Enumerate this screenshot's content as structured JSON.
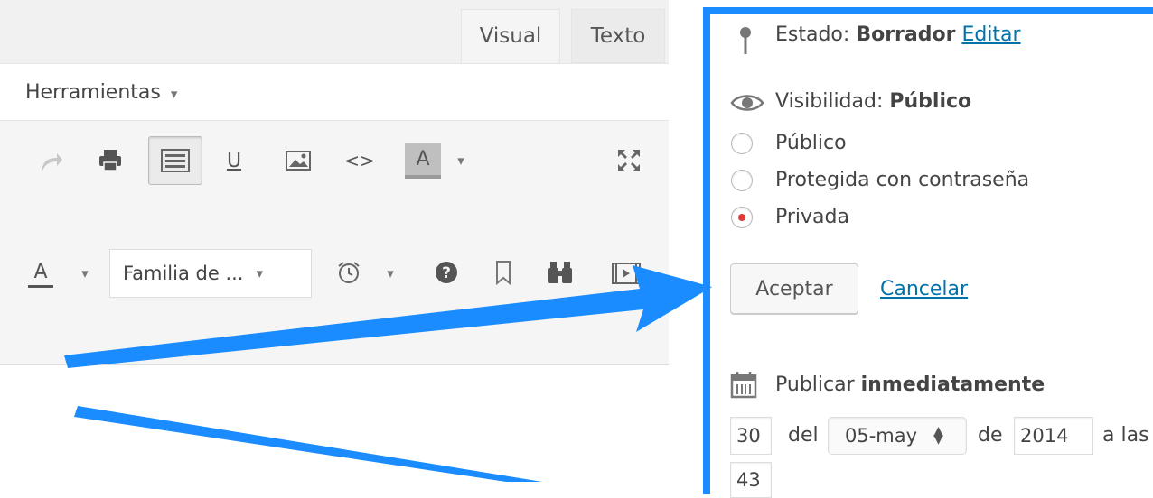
{
  "editor": {
    "tabs": [
      {
        "label": "Visual"
      },
      {
        "label": "Texto"
      }
    ],
    "menu_label": "Herramientas",
    "font_family_value": "Familia de ...",
    "text_color_letter": "A",
    "bg_color_letter": "A",
    "underline_letter": "U",
    "code_glyph": "<>",
    "dropdown_arrow": "▾"
  },
  "publish": {
    "status_label": "Estado:",
    "status_value": "Borrador",
    "status_edit": "Editar",
    "visibility_label": "Visibilidad:",
    "visibility_value": "Público",
    "options": [
      {
        "label": "Público",
        "checked": false
      },
      {
        "label": "Protegida con contraseña",
        "checked": false
      },
      {
        "label": "Privada",
        "checked": true
      }
    ],
    "accept_label": "Aceptar",
    "cancel_label": "Cancelar",
    "publish_label": "Publicar",
    "publish_value": "inmediatamente",
    "day_value": "30",
    "del_label": "del",
    "month_value": "05-may",
    "de_label": "de",
    "year_value": "2014",
    "at_label": "a las",
    "hour_value": "43"
  },
  "colors": {
    "accent": "#1a8cff",
    "link": "#0073aa",
    "radio_checked": "#dd3d36"
  }
}
